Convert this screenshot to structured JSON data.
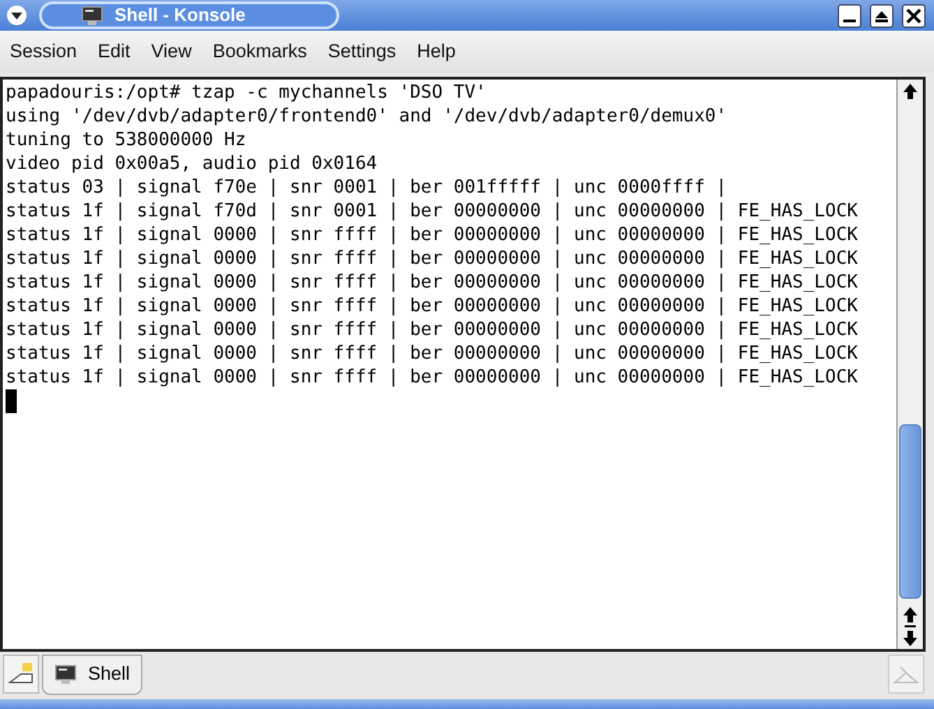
{
  "window": {
    "title": "Shell - Konsole"
  },
  "menu": [
    "Session",
    "Edit",
    "View",
    "Bookmarks",
    "Settings",
    "Help"
  ],
  "terminal": {
    "lines": [
      "papadouris:/opt# tzap -c mychannels 'DSO TV'",
      "using '/dev/dvb/adapter0/frontend0' and '/dev/dvb/adapter0/demux0'",
      "tuning to 538000000 Hz",
      "video pid 0x00a5, audio pid 0x0164",
      "status 03 | signal f70e | snr 0001 | ber 001fffff | unc 0000ffff |",
      "status 1f | signal f70d | snr 0001 | ber 00000000 | unc 00000000 | FE_HAS_LOCK",
      "status 1f | signal 0000 | snr ffff | ber 00000000 | unc 00000000 | FE_HAS_LOCK",
      "status 1f | signal 0000 | snr ffff | ber 00000000 | unc 00000000 | FE_HAS_LOCK",
      "status 1f | signal 0000 | snr ffff | ber 00000000 | unc 00000000 | FE_HAS_LOCK",
      "status 1f | signal 0000 | snr ffff | ber 00000000 | unc 00000000 | FE_HAS_LOCK",
      "status 1f | signal 0000 | snr ffff | ber 00000000 | unc 00000000 | FE_HAS_LOCK",
      "status 1f | signal 0000 | snr ffff | ber 00000000 | unc 00000000 | FE_HAS_LOCK",
      "status 1f | signal 0000 | snr ffff | ber 00000000 | unc 00000000 | FE_HAS_LOCK"
    ]
  },
  "tabs": [
    {
      "label": "Shell",
      "selected": true
    }
  ]
}
